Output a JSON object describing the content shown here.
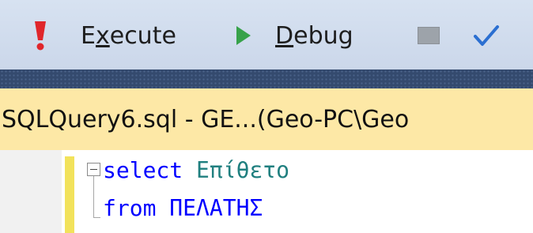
{
  "toolbar": {
    "execute_pre": "E",
    "execute_accel": "x",
    "execute_post": "ecute",
    "debug_accel": "D",
    "debug_post": "ebug",
    "icons": {
      "execute": "exclamation-icon",
      "debug": "play-triangle-icon",
      "stop": "stop-square-icon",
      "parse": "checkmark-icon"
    },
    "colors": {
      "execute_icon": "#e0262b",
      "debug_icon": "#37a24a",
      "parse_icon": "#2b6fd1",
      "stop_icon": "#9da3aa"
    }
  },
  "document_tab": {
    "title": "SQLQuery6.sql - GE...(Geo-PC\\Geo",
    "color": "#fde8a6"
  },
  "editor": {
    "lines": [
      {
        "keyword": "select",
        "text": "Επίθετο"
      },
      {
        "keyword": "from",
        "text": "ΠΕΛΑΤΗΣ"
      }
    ],
    "colors": {
      "keyword": "#0000ff",
      "identifier": "#1f7f7f",
      "change_bar": "#f2e25b"
    }
  }
}
